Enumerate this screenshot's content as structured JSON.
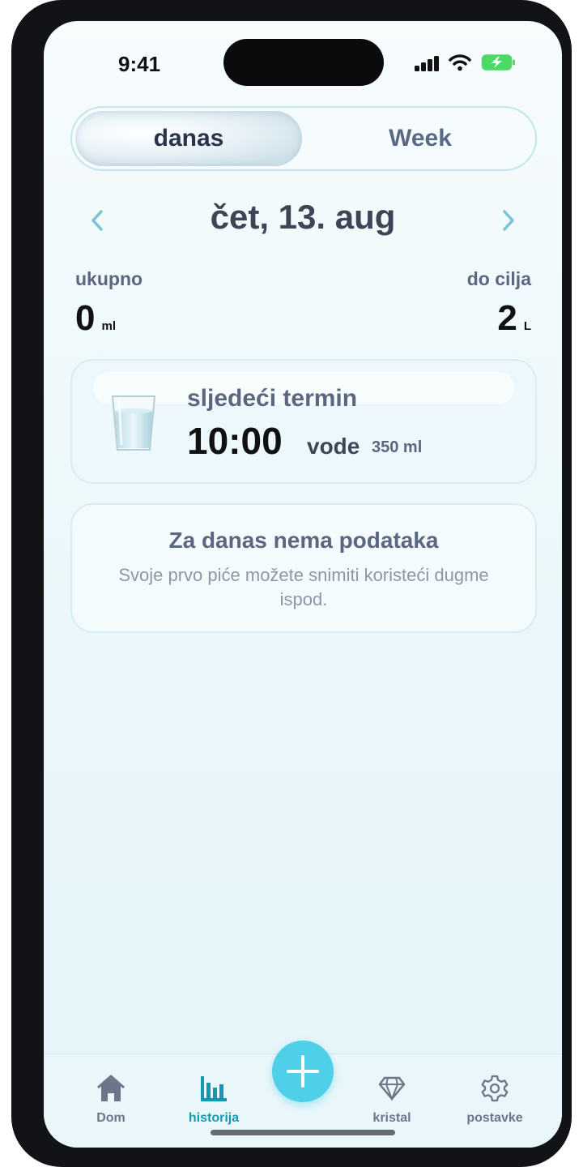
{
  "status_bar": {
    "time": "9:41"
  },
  "segmented": {
    "active": "danas",
    "inactive": "Week"
  },
  "date_nav": {
    "date": "čet, 13. aug",
    "prev_icon": "chevron-left-icon",
    "next_icon": "chevron-right-icon"
  },
  "totals": {
    "left_label": "ukupno",
    "left_value": "0",
    "left_unit": "ml",
    "right_label": "do cilja",
    "right_value": "2",
    "right_unit": "L"
  },
  "next_card": {
    "title": "sljedeći termin",
    "time": "10:00",
    "drink": "vode",
    "amount": "350 ml",
    "icon": "water-glass-icon"
  },
  "empty_card": {
    "title": "Za danas nema podataka",
    "text": "Svoje prvo piće možete snimiti koristeći dugme ispod."
  },
  "tabbar": {
    "items": [
      {
        "label": "Dom",
        "icon": "home-icon",
        "active": false
      },
      {
        "label": "historija",
        "icon": "bar-chart-icon",
        "active": true
      },
      {
        "label": "kristal",
        "icon": "diamond-icon",
        "active": false
      },
      {
        "label": "postavke",
        "icon": "gear-icon",
        "active": false
      }
    ],
    "fab_icon": "plus-icon"
  },
  "colors": {
    "accent": "#4fd0e8",
    "active_tab": "#1597b3",
    "text_dark": "#111111",
    "text_muted": "#5b6680"
  }
}
